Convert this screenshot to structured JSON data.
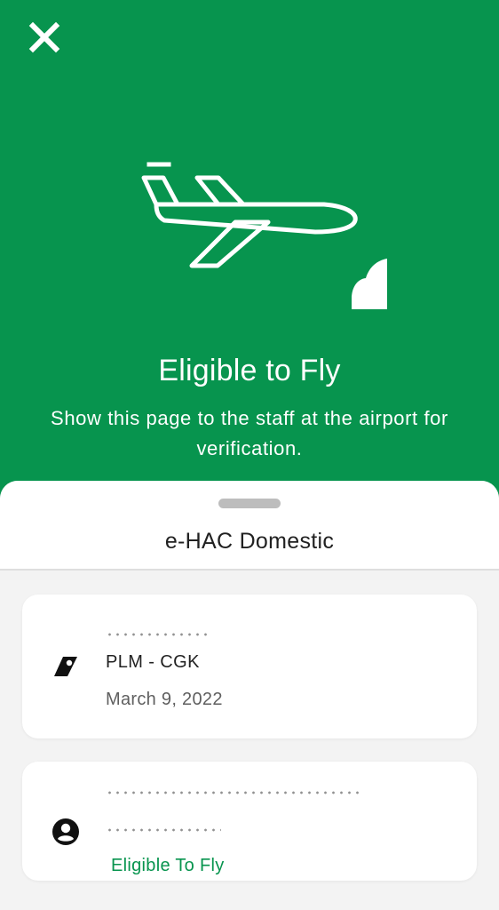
{
  "colors": {
    "primary_green": "#07944e",
    "sheet_background": "#f3f3f3",
    "card_background": "#ffffff"
  },
  "header": {
    "close_icon": "close-icon",
    "illustration": "airplane-with-cloud",
    "title": "Eligible to Fly",
    "subtitle": "Show this page to the staff at the airport for verification."
  },
  "sheet": {
    "title": "e-HAC Domestic"
  },
  "flight_card": {
    "icon": "airplane-tail-icon",
    "route": "PLM - CGK",
    "date": "March 9, 2022"
  },
  "passenger_card": {
    "icon": "account-circle-icon",
    "status": "Eligible To Fly"
  }
}
